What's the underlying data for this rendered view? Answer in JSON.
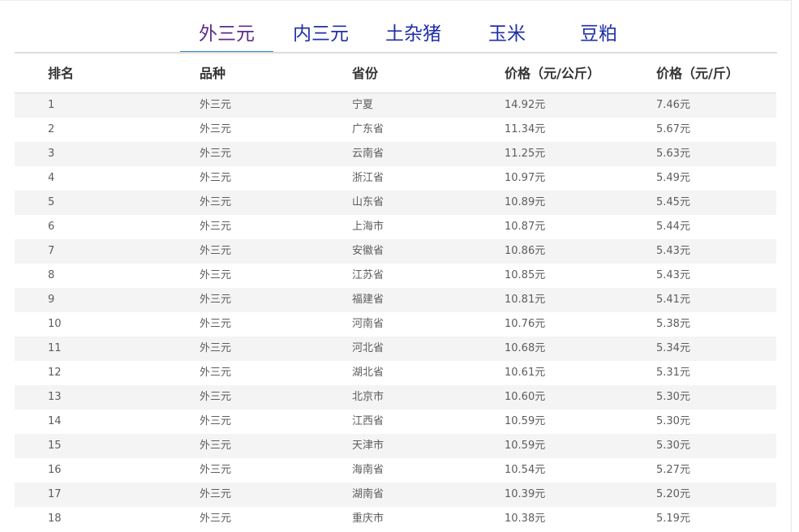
{
  "tabs": [
    {
      "label": "外三元",
      "active": true
    },
    {
      "label": "内三元",
      "active": false
    },
    {
      "label": "土杂猪",
      "active": false
    },
    {
      "label": "玉米",
      "active": false
    },
    {
      "label": "豆粕",
      "active": false
    }
  ],
  "table": {
    "headers": [
      "排名",
      "品种",
      "省份",
      "价格（元/公斤）",
      "价格（元/斤）"
    ],
    "rows": [
      [
        "1",
        "外三元",
        "宁夏",
        "14.92元",
        "7.46元"
      ],
      [
        "2",
        "外三元",
        "广东省",
        "11.34元",
        "5.67元"
      ],
      [
        "3",
        "外三元",
        "云南省",
        "11.25元",
        "5.63元"
      ],
      [
        "4",
        "外三元",
        "浙江省",
        "10.97元",
        "5.49元"
      ],
      [
        "5",
        "外三元",
        "山东省",
        "10.89元",
        "5.45元"
      ],
      [
        "6",
        "外三元",
        "上海市",
        "10.87元",
        "5.44元"
      ],
      [
        "7",
        "外三元",
        "安徽省",
        "10.86元",
        "5.43元"
      ],
      [
        "8",
        "外三元",
        "江苏省",
        "10.85元",
        "5.43元"
      ],
      [
        "9",
        "外三元",
        "福建省",
        "10.81元",
        "5.41元"
      ],
      [
        "10",
        "外三元",
        "河南省",
        "10.76元",
        "5.38元"
      ],
      [
        "11",
        "外三元",
        "河北省",
        "10.68元",
        "5.34元"
      ],
      [
        "12",
        "外三元",
        "湖北省",
        "10.61元",
        "5.31元"
      ],
      [
        "13",
        "外三元",
        "北京市",
        "10.60元",
        "5.30元"
      ],
      [
        "14",
        "外三元",
        "江西省",
        "10.59元",
        "5.30元"
      ],
      [
        "15",
        "外三元",
        "天津市",
        "10.59元",
        "5.30元"
      ],
      [
        "16",
        "外三元",
        "海南省",
        "10.54元",
        "5.27元"
      ],
      [
        "17",
        "外三元",
        "湖南省",
        "10.39元",
        "5.20元"
      ],
      [
        "18",
        "外三元",
        "重庆市",
        "10.38元",
        "5.19元"
      ]
    ]
  },
  "colors": {
    "tab_text": "#1f2fa8",
    "tab_active_text": "#5e2a8a",
    "tab_underline": "#2a8ed6",
    "row_alt_bg": "#f4f4f4"
  }
}
